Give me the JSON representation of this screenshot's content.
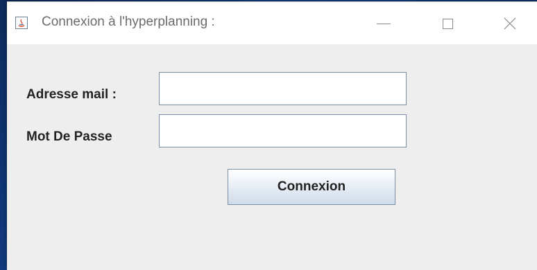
{
  "window": {
    "title": "Connexion à l'hyperplanning :",
    "icon": "java-app-icon"
  },
  "form": {
    "email_label": "Adresse mail :",
    "email_value": "",
    "password_label": "Mot De Passe",
    "password_value": "",
    "submit_label": "Connexion"
  },
  "colors": {
    "window_background": "#eeeeee",
    "titlebar_background": "#ffffff",
    "desktop_background": "#123e86",
    "input_border": "#7a8ea6"
  }
}
